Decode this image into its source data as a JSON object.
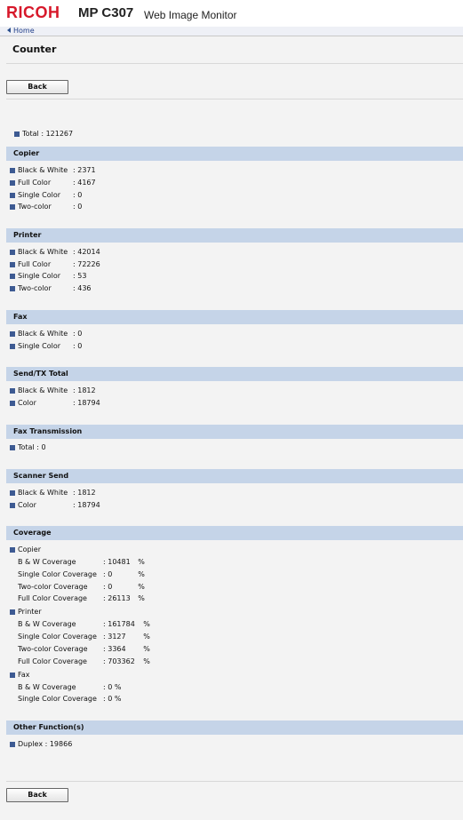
{
  "header": {
    "logo": "RICOH",
    "model": "MP C307",
    "product": "Web Image Monitor"
  },
  "breadcrumb": {
    "home": "Home"
  },
  "page_title": "Counter",
  "buttons": {
    "back": "Back"
  },
  "total": {
    "label": "Total",
    "value": "121267"
  },
  "sections": {
    "copier": {
      "title": "Copier",
      "rows": [
        {
          "label": "Black & White",
          "value": "2371"
        },
        {
          "label": "Full Color",
          "value": "4167"
        },
        {
          "label": "Single Color",
          "value": "0"
        },
        {
          "label": "Two-color",
          "value": "0"
        }
      ]
    },
    "printer": {
      "title": "Printer",
      "rows": [
        {
          "label": "Black & White",
          "value": "42014"
        },
        {
          "label": "Full Color",
          "value": "72226"
        },
        {
          "label": "Single Color",
          "value": "53"
        },
        {
          "label": "Two-color",
          "value": "436"
        }
      ]
    },
    "fax": {
      "title": "Fax",
      "rows": [
        {
          "label": "Black & White",
          "value": "0"
        },
        {
          "label": "Single Color",
          "value": "0"
        }
      ]
    },
    "send_tx": {
      "title": "Send/TX Total",
      "rows": [
        {
          "label": "Black & White",
          "value": "1812"
        },
        {
          "label": "Color",
          "value": "18794"
        }
      ]
    },
    "fax_transmission": {
      "title": "Fax Transmission",
      "rows": [
        {
          "label": "Total",
          "value": "0"
        }
      ]
    },
    "scanner_send": {
      "title": "Scanner Send",
      "rows": [
        {
          "label": "Black & White",
          "value": "1812"
        },
        {
          "label": "Color",
          "value": "18794"
        }
      ]
    },
    "coverage": {
      "title": "Coverage",
      "copier": {
        "label": "Copier",
        "rows": [
          {
            "label": "B & W Coverage",
            "value": "10481",
            "unit": "%"
          },
          {
            "label": "Single Color Coverage",
            "value": "0",
            "unit": "%"
          },
          {
            "label": "Two-color Coverage",
            "value": "0",
            "unit": "%"
          },
          {
            "label": "Full Color Coverage",
            "value": "26113",
            "unit": "%"
          }
        ]
      },
      "printer": {
        "label": "Printer",
        "rows": [
          {
            "label": "B & W Coverage",
            "value": "161784",
            "unit": "%"
          },
          {
            "label": "Single Color Coverage",
            "value": "3127",
            "unit": "%"
          },
          {
            "label": "Two-color Coverage",
            "value": "3364",
            "unit": "%"
          },
          {
            "label": "Full Color Coverage",
            "value": "703362",
            "unit": "%"
          }
        ]
      },
      "fax": {
        "label": "Fax",
        "rows": [
          {
            "label": "B & W Coverage",
            "value": "0",
            "unit": "%"
          },
          {
            "label": "Single Color Coverage",
            "value": "0",
            "unit": "%"
          }
        ]
      }
    },
    "other": {
      "title": "Other Function(s)",
      "rows": [
        {
          "label": "Duplex",
          "value": "19866"
        }
      ]
    }
  },
  "colors": {
    "brand": "#d7182a",
    "section_header": "#c5d4e8",
    "bullet": "#3d5a92",
    "link": "#23408a",
    "background": "#f3f3f3"
  }
}
